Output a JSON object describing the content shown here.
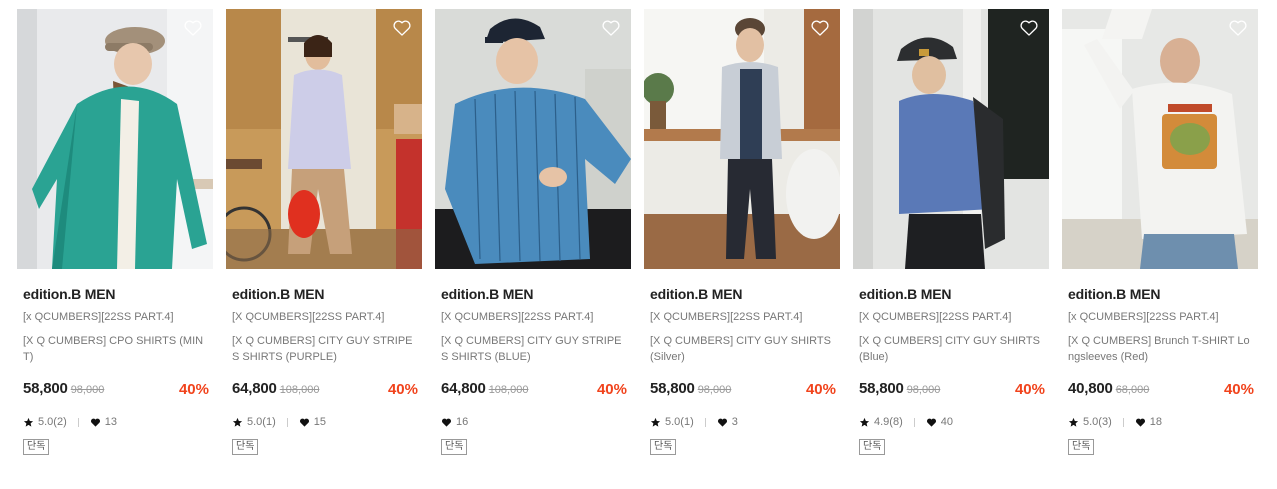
{
  "products": [
    {
      "brand": "edition.B MEN",
      "collection": "[x QCUMBERS][22SS PART.4]",
      "name": "[X Q CUMBERS] CPO SHIRTS (MINT)",
      "price": "58,800",
      "original_price": "98,000",
      "discount": "40%",
      "rating": "5.0(2)",
      "likes": "13",
      "tag": "단독",
      "image_alt": "model in mint CPO shirt and beige cap"
    },
    {
      "brand": "edition.B MEN",
      "collection": "[X QCUMBERS][22SS PART.4]",
      "name": "[X Q CUMBERS] CITY GUY STRIPES SHIRTS (PURPLE)",
      "price": "64,800",
      "original_price": "108,000",
      "discount": "40%",
      "rating": "5.0(1)",
      "likes": "15",
      "tag": "단독",
      "image_alt": "model in purple striped shirt holding red bag"
    },
    {
      "brand": "edition.B MEN",
      "collection": "[X QCUMBERS][22SS PART.4]",
      "name": "[X Q CUMBERS] CITY GUY STRIPES SHIRTS (BLUE)",
      "price": "64,800",
      "original_price": "108,000",
      "discount": "40%",
      "rating": null,
      "likes": "16",
      "tag": "단독",
      "image_alt": "model in blue striped shirt and navy cap"
    },
    {
      "brand": "edition.B MEN",
      "collection": "[X QCUMBERS][22SS PART.4]",
      "name": "[X Q CUMBERS] CITY GUY SHIRTS (Silver)",
      "price": "58,800",
      "original_price": "98,000",
      "discount": "40%",
      "rating": "5.0(1)",
      "likes": "3",
      "tag": "단독",
      "image_alt": "model in silver shirt leaning on window ledge"
    },
    {
      "brand": "edition.B MEN",
      "collection": "[X QCUMBERS][22SS PART.4]",
      "name": "[X Q CUMBERS] CITY GUY SHIRTS (Blue)",
      "price": "58,800",
      "original_price": "98,000",
      "discount": "40%",
      "rating": "4.9(8)",
      "likes": "40",
      "tag": "단독",
      "image_alt": "model in blue shirt with backpack and cap"
    },
    {
      "brand": "edition.B MEN",
      "collection": "[x QCUMBERS][22SS PART.4]",
      "name": "[X Q CUMBERS] Brunch T-SHIRT Longsleeves (Red)",
      "price": "40,800",
      "original_price": "68,000",
      "discount": "40%",
      "rating": "5.0(3)",
      "likes": "18",
      "tag": "단독",
      "image_alt": "model in white long sleeve t-shirt with brunch graphic"
    }
  ],
  "colors": {
    "discount": "#f1431c",
    "text": "#222222",
    "muted": "#777777"
  },
  "icons": {
    "wishlist": "heart-outline-icon",
    "rating": "star-icon",
    "likes": "heart-filled-icon"
  }
}
